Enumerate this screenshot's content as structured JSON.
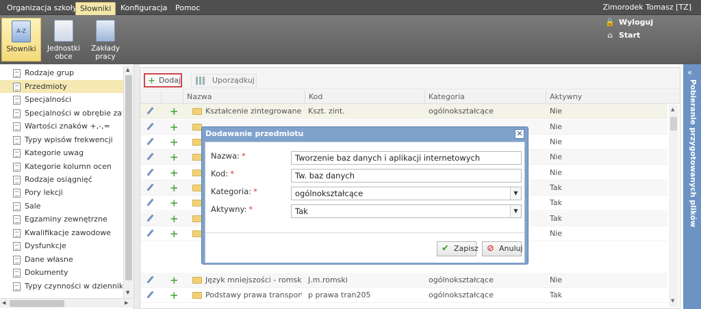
{
  "menu": {
    "tabs": [
      "Organizacja szkoły",
      "Słowniki",
      "Konfiguracja",
      "Pomoc"
    ],
    "active": 1
  },
  "user": {
    "name": "Zimorodek Tomasz [TZ]"
  },
  "ribbon": {
    "buttons": [
      {
        "label1": "Słowniki",
        "label2": ""
      },
      {
        "label1": "Jednostki",
        "label2": "obce"
      },
      {
        "label1": "Zakłady",
        "label2": "pracy"
      }
    ],
    "links": {
      "logout": "Wyloguj",
      "start": "Start"
    }
  },
  "sidebar": {
    "items": [
      "Rodzaje grup",
      "Przedmioty",
      "Specjalności",
      "Specjalności w obrębie zawodu",
      "Wartości znaków +,-,=",
      "Typy wpisów frekwencji",
      "Kategorie uwag",
      "Kategorie kolumn ocen",
      "Rodzaje osiągnięć",
      "Pory lekcji",
      "Sale",
      "Egzaminy zewnętrzne",
      "Kwalifikacje zawodowe",
      "Dysfunkcje",
      "Dane własne",
      "Dokumenty",
      "Typy czynności w dzienniku zajęć"
    ],
    "selected": 1
  },
  "toolbar": {
    "add_label": "Dodaj",
    "order_label": "Uporządkuj"
  },
  "grid": {
    "columns": [
      "Nazwa",
      "Kod",
      "Kategoria",
      "Aktywny"
    ],
    "rows": [
      {
        "nazwa": "Kształcenie zintegrowane",
        "kod": "Kszt. zint.",
        "kategoria": "ogólnokształcące",
        "aktywny": "Nie"
      },
      {
        "nazwa": "",
        "kod": "",
        "kategoria": "",
        "aktywny": "Nie"
      },
      {
        "nazwa": "",
        "kod": "",
        "kategoria": "",
        "aktywny": "Nie"
      },
      {
        "nazwa": "",
        "kod": "",
        "kategoria": "",
        "aktywny": "Nie"
      },
      {
        "nazwa": "",
        "kod": "",
        "kategoria": "",
        "aktywny": "Nie"
      },
      {
        "nazwa": "",
        "kod": "",
        "kategoria": "",
        "aktywny": "Tak"
      },
      {
        "nazwa": "",
        "kod": "",
        "kategoria": "",
        "aktywny": "Tak"
      },
      {
        "nazwa": "",
        "kod": "",
        "kategoria": "",
        "aktywny": "Tak"
      },
      {
        "nazwa": "",
        "kod": "",
        "kategoria": "",
        "aktywny": "Nie"
      },
      {
        "nazwa": "Język mniejszości - romski",
        "kod": "J.m.romski",
        "kategoria": "ogólnokształcące",
        "aktywny": "Nie"
      },
      {
        "nazwa": "Podstawy prawa transport...",
        "kod": "p prawa tran205",
        "kategoria": "ogólnokształcące",
        "aktywny": "Tak"
      }
    ]
  },
  "right_panel": {
    "label": "Pobieranie przygotowanych plików"
  },
  "dialog": {
    "title": "Dodawanie przedmiotu",
    "fields": [
      {
        "label": "Nazwa:",
        "value": "Tworzenie baz danych i aplikacji internetowych"
      },
      {
        "label": "Kod:",
        "value": "Tw. baz danych"
      },
      {
        "label": "Kategoria:",
        "value": "ogólnokształcące"
      },
      {
        "label": "Aktywny:",
        "value": "Tak"
      }
    ],
    "required_mark": "*",
    "save_label": "Zapisz",
    "cancel_label": "Anuluj"
  },
  "colors": {
    "accent": "#6d93c5",
    "selected": "#f5e8b3",
    "required": "#d63b3b",
    "add_outline": "#c9252c"
  }
}
